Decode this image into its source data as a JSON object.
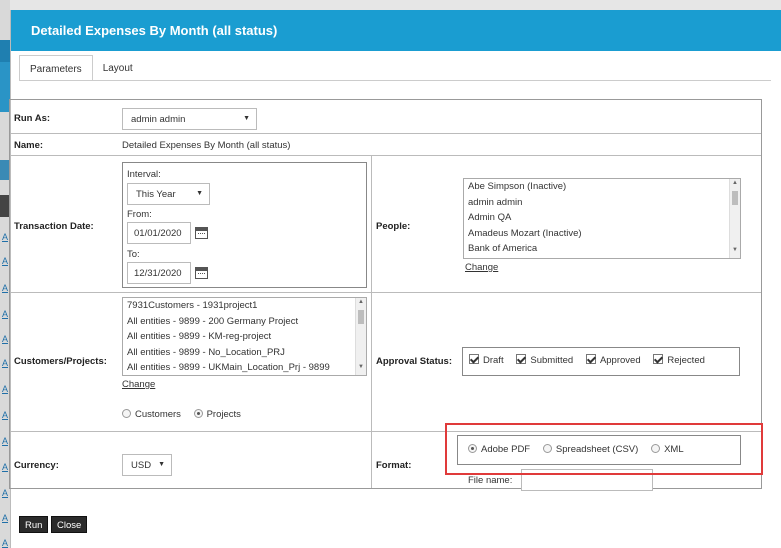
{
  "background": {
    "links": [
      "A",
      "A",
      "A",
      "A",
      "A",
      "A",
      "A",
      "A",
      "A",
      "A",
      "A",
      "A",
      "A",
      "A"
    ]
  },
  "modal": {
    "title": "Detailed Expenses By Month (all status)"
  },
  "tabs": [
    {
      "label": "Parameters",
      "active": true
    },
    {
      "label": "Layout",
      "active": false
    }
  ],
  "run_as": {
    "label": "Run As:",
    "value": "admin admin"
  },
  "name": {
    "label": "Name:",
    "value": "Detailed Expenses By Month (all status)"
  },
  "transaction_date": {
    "label": "Transaction Date:",
    "interval_label": "Interval:",
    "interval_value": "This Year",
    "from_label": "From:",
    "from_value": "01/01/2020",
    "to_label": "To:",
    "to_value": "12/31/2020"
  },
  "people": {
    "label": "People:",
    "items": [
      "Abe Simpson (Inactive)",
      "admin admin",
      "Admin QA",
      "Amadeus Mozart (Inactive)",
      "Bank of America"
    ],
    "change_label": "Change"
  },
  "customers_projects": {
    "label": "Customers/Projects:",
    "items": [
      "7931Customers - 1931project1",
      "All entities - 9899 - 200 Germany Project",
      "All entities - 9899 - KM-reg-project",
      "All entities - 9899 - No_Location_PRJ",
      "All entities - 9899 - UKMain_Location_Prj - 9899"
    ],
    "change_label": "Change",
    "radio_customers": "Customers",
    "radio_projects": "Projects",
    "selected": "Projects"
  },
  "approval_status": {
    "label": "Approval Status:",
    "options": [
      "Draft",
      "Submitted",
      "Approved",
      "Rejected"
    ]
  },
  "currency": {
    "label": "Currency:",
    "value": "USD"
  },
  "format": {
    "label": "Format:",
    "options": [
      "Adobe PDF",
      "Spreadsheet (CSV)",
      "XML"
    ],
    "selected": "Adobe PDF",
    "file_name_label": "File name:",
    "file_name_value": ""
  },
  "buttons": {
    "run": "Run",
    "close": "Close"
  },
  "colors": {
    "header": "#1a9dd1",
    "highlight": "#e03a3a",
    "button": "#2b2b2b"
  }
}
